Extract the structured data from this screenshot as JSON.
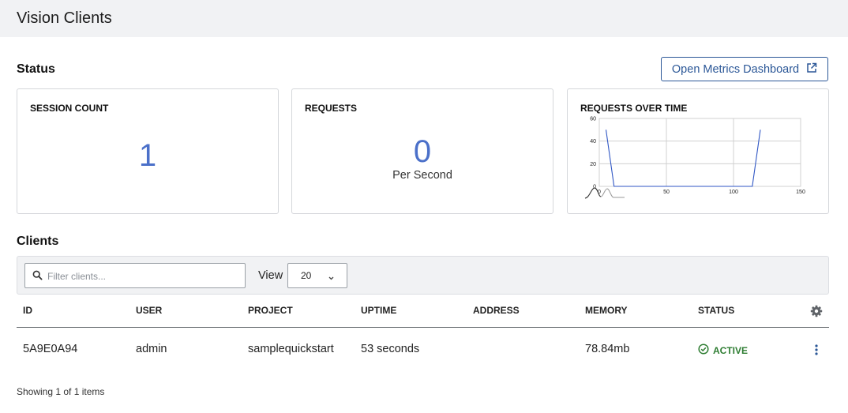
{
  "header": {
    "title": "Vision Clients"
  },
  "status_section": {
    "title": "Status",
    "open_metrics_label": "Open Metrics Dashboard",
    "session_card": {
      "title": "SESSION COUNT",
      "value": "1"
    },
    "requests_card": {
      "title": "REQUESTS",
      "value": "0",
      "unit": "Per Second"
    },
    "chart_card": {
      "title": "REQUESTS OVER TIME"
    }
  },
  "chart_data": {
    "type": "line",
    "title": "REQUESTS OVER TIME",
    "xlabel": "",
    "ylabel": "",
    "xlim": [
      0,
      150
    ],
    "ylim": [
      0,
      60
    ],
    "x_ticks": [
      "0",
      "50",
      "100",
      "150"
    ],
    "y_ticks": [
      "0",
      "20",
      "40",
      "60"
    ],
    "grid": true,
    "series": [
      {
        "x": [
          5,
          11,
          114,
          120
        ],
        "values": [
          50,
          0,
          0,
          50
        ]
      }
    ],
    "colors": {
      "line": "#2f56c4",
      "grid": "#d0d0d0"
    }
  },
  "clients_section": {
    "title": "Clients",
    "filter_placeholder": "Filter clients...",
    "view_label": "View",
    "view_value": "20",
    "columns": [
      "ID",
      "USER",
      "PROJECT",
      "UPTIME",
      "ADDRESS",
      "MEMORY",
      "STATUS"
    ],
    "rows": [
      {
        "id": "5A9E0A94",
        "user": "admin",
        "project": "samplequickstart",
        "uptime": "53 seconds",
        "address": "",
        "memory": "78.84mb",
        "status": "ACTIVE"
      }
    ],
    "footer": "Showing 1 of 1 items"
  },
  "colors": {
    "accent": "#2b5797",
    "number": "#4b70c9",
    "active": "#2e7d32",
    "topbar": "#f1f2f4"
  },
  "icons": {
    "open": "external-link-icon",
    "search": "search-icon",
    "chevron": "chevron-down-icon",
    "settings": "gear-icon",
    "status": "check-circle-icon",
    "row_menu": "kebab-icon"
  }
}
